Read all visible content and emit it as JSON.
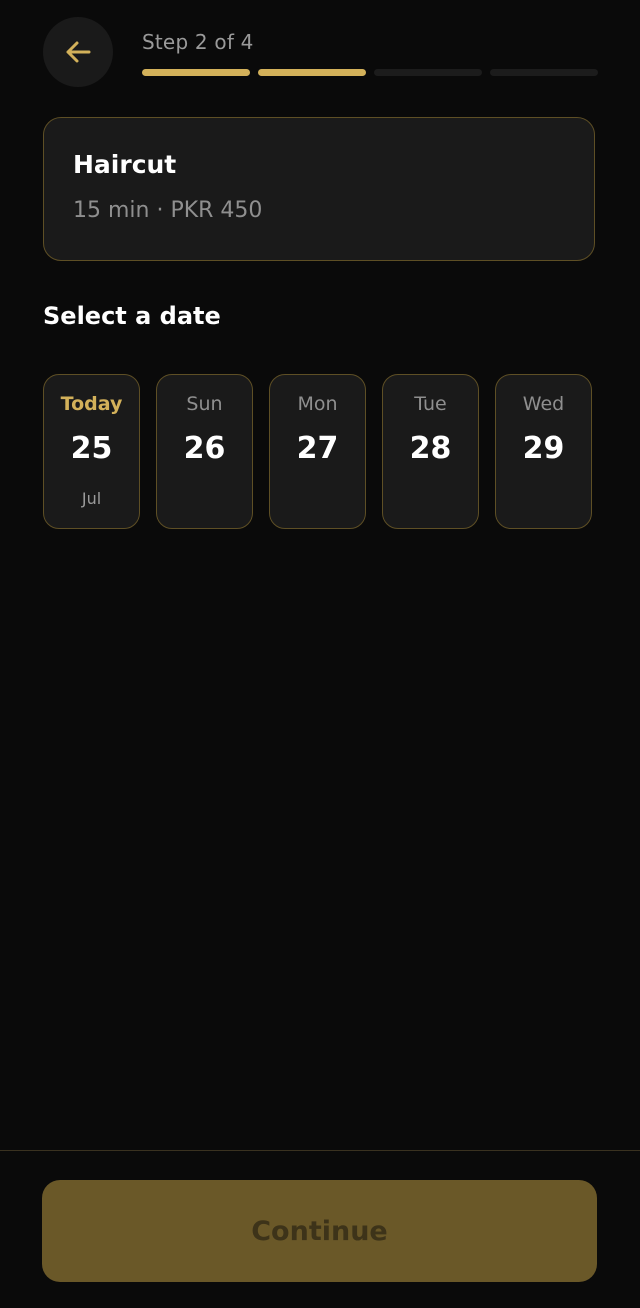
{
  "header": {
    "back_icon": "arrow-left-icon",
    "step_label": "Step 2 of 4",
    "progress": {
      "current_step": 2,
      "total_steps": 4
    }
  },
  "service": {
    "name": "Haircut",
    "meta": "15 min · PKR 450"
  },
  "date_section": {
    "title": "Select a date",
    "dates": [
      {
        "dow": "Today",
        "day": "25",
        "month": "Jul",
        "is_today": true
      },
      {
        "dow": "Sun",
        "day": "26",
        "month": ""
      },
      {
        "dow": "Mon",
        "day": "27",
        "month": ""
      },
      {
        "dow": "Tue",
        "day": "28",
        "month": ""
      },
      {
        "dow": "Wed",
        "day": "29",
        "month": ""
      }
    ]
  },
  "footer": {
    "continue_label": "Continue",
    "continue_enabled": false
  },
  "colors": {
    "background": "#0a0a0a",
    "accent": "#d3b15a",
    "card": "#1a1a1a",
    "card_border": "#5e4f25",
    "button_disabled": "#6a5828"
  }
}
